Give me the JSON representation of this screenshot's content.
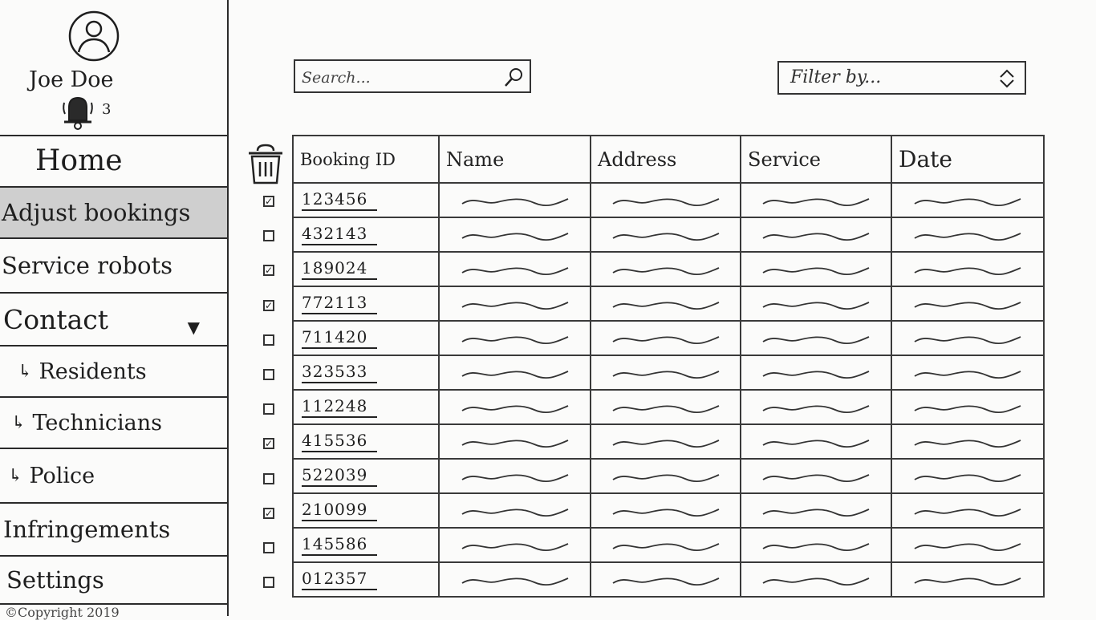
{
  "profile": {
    "user_name": "Joe Doe",
    "notification_count": "3"
  },
  "sidebar": {
    "items": [
      {
        "label": "Home",
        "active": false
      },
      {
        "label": "Adjust bookings",
        "active": true
      },
      {
        "label": "Service robots",
        "active": false
      },
      {
        "label": "Contact",
        "active": false
      },
      {
        "label": "Residents",
        "active": false
      },
      {
        "label": "Technicians",
        "active": false
      },
      {
        "label": "Police",
        "active": false
      },
      {
        "label": "Infringements",
        "active": false
      },
      {
        "label": "Settings",
        "active": false
      }
    ],
    "copyright": "©Copyright 2019"
  },
  "search": {
    "placeholder": "Search..."
  },
  "filter": {
    "label": "Filter by..."
  },
  "icons": {
    "avatar": "user-avatar-icon",
    "bell": "bell-icon",
    "search": "magnifier-icon",
    "filter": "up-down-arrows-icon",
    "delete": "trash-icon",
    "expand": "triangle-down-icon",
    "sub_item": "corner-arrow-icon"
  },
  "table": {
    "columns": [
      "Booking ID",
      "Name",
      "Address",
      "Service",
      "Date"
    ],
    "rows": [
      {
        "id": "123456",
        "checked": true
      },
      {
        "id": "432143",
        "checked": false
      },
      {
        "id": "189024",
        "checked": true
      },
      {
        "id": "772113",
        "checked": true
      },
      {
        "id": "711420",
        "checked": false
      },
      {
        "id": "323533",
        "checked": false
      },
      {
        "id": "112248",
        "checked": false
      },
      {
        "id": "415536",
        "checked": true
      },
      {
        "id": "522039",
        "checked": false
      },
      {
        "id": "210099",
        "checked": true
      },
      {
        "id": "145586",
        "checked": false
      },
      {
        "id": "012357",
        "checked": false
      }
    ]
  }
}
